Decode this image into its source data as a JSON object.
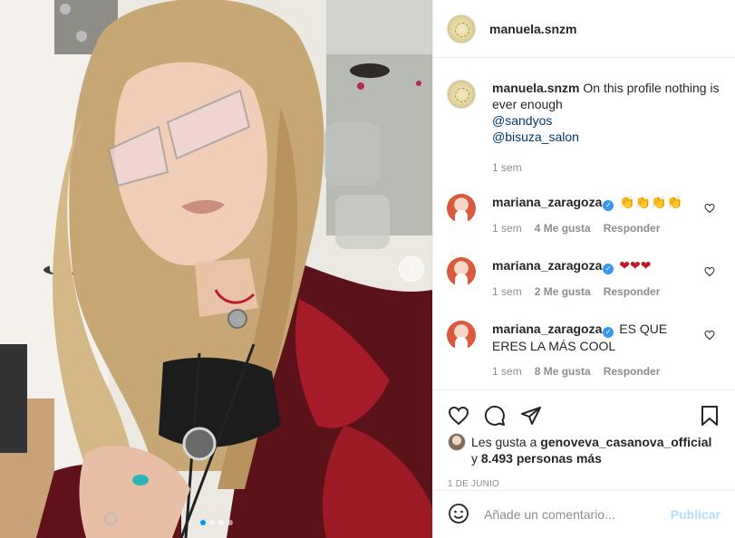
{
  "post": {
    "username": "manuela.snzm",
    "caption": "On this profile nothing is ever enough",
    "mentions": [
      "@sandyos",
      "@bisuza_salon"
    ],
    "caption_time": "1 sem"
  },
  "comments": [
    {
      "user": "mariana_zaragoza",
      "text": "👏👏👏👏",
      "time": "1 sem",
      "likes": "4 Me gusta",
      "reply": "Responder"
    },
    {
      "user": "mariana_zaragoza",
      "text": "❤❤❤",
      "time": "1 sem",
      "likes": "2 Me gusta",
      "reply": "Responder"
    },
    {
      "user": "mariana_zaragoza",
      "text": "ES QUE ERES LA MÁS COOL",
      "time": "1 sem",
      "likes": "8 Me gusta",
      "reply": "Responder"
    }
  ],
  "likes": {
    "prefix": "Les gusta a",
    "user": "genoveva_casanova_official",
    "conjunction": "y",
    "others": "8.493 personas más"
  },
  "date": "1 DE JUNIO",
  "add_comment": {
    "placeholder": "Añade un comentario...",
    "publish_label": "Publicar"
  },
  "carousel": {
    "slides": 4,
    "active": 0
  },
  "icons": [
    "heart-icon",
    "comment-icon",
    "share-icon",
    "bookmark-icon",
    "emoji-icon",
    "chevron-right-icon"
  ],
  "colors": {
    "link": "#00376b",
    "muted": "#8e8e8e",
    "verified": "#3897f0",
    "publish": "#b2dffc",
    "active_dot": "#0095f6"
  }
}
